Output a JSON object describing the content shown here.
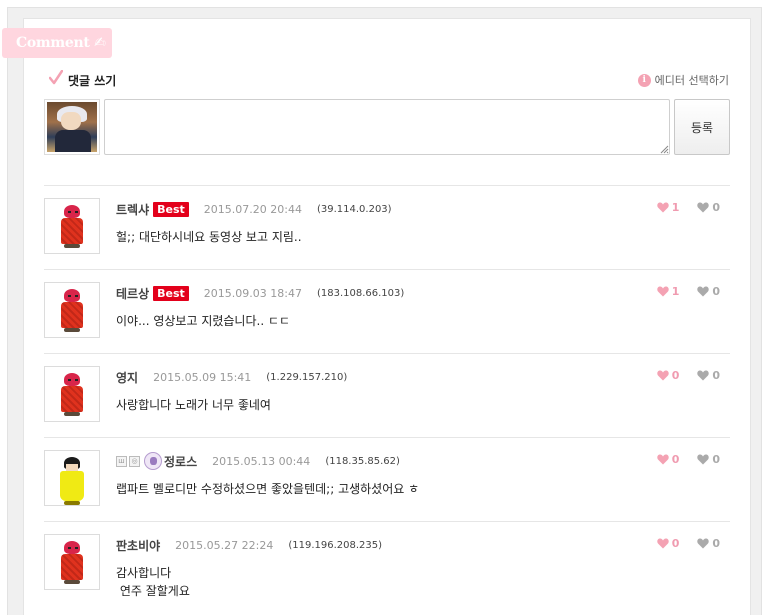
{
  "section_tag": "Comment",
  "write": {
    "title": "댓글 쓰기",
    "editor_select": "에디터 선택하기",
    "input_value": "",
    "submit_label": "등록"
  },
  "colors": {
    "accent_pink": "#f4a2b3",
    "best_red": "#e3001b",
    "tag_pink": "#ffd6df"
  },
  "comments": [
    {
      "author": "트렉샤",
      "best": "Best",
      "date": "2015.07.20 20:44",
      "ip": "(39.114.0.203)",
      "text": "헐;; 대단하시네요 동영상 보고 지림..",
      "likes": "1",
      "dislikes": "0"
    },
    {
      "author": "테르상",
      "best": "Best",
      "date": "2015.09.03 18:47",
      "ip": "(183.108.66.103)",
      "text": "이야... 영상보고 지렸습니다.. ㄷㄷ",
      "likes": "1",
      "dislikes": "0"
    },
    {
      "author": "영지",
      "date": "2015.05.09 15:41",
      "ip": "(1.229.157.210)",
      "text": "사랑합니다 노래가 너무 좋네여",
      "likes": "0",
      "dislikes": "0"
    },
    {
      "author": "정로스",
      "date": "2015.05.13 00:44",
      "ip": "(118.35.85.62)",
      "text": "랩파트 멜로디만 수정하셨으면 좋았을텐데;; 고생하셨어요 ㅎ",
      "likes": "0",
      "dislikes": "0"
    },
    {
      "author": "판초비야",
      "date": "2015.05.27 22:24",
      "ip": "(119.196.208.235)",
      "text": "감사합니다\n 연주 잘할게요",
      "likes": "0",
      "dislikes": "0"
    }
  ]
}
